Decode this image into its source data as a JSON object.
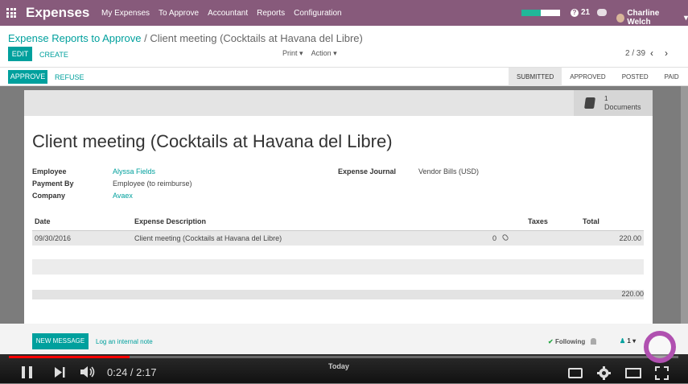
{
  "app": {
    "title": "Expenses"
  },
  "menu": [
    "My Expenses",
    "To Approve",
    "Accountant",
    "Reports",
    "Configuration"
  ],
  "systray": {
    "messages_count": "21",
    "user_name": "Charline Welch"
  },
  "breadcrumb": {
    "parent": "Expense Reports to Approve",
    "separator": "/",
    "current": "Client meeting (Cocktails at Havana del Libre)"
  },
  "control": {
    "edit_label": "EDIT",
    "create_label": "CREATE",
    "print_label": "Print",
    "action_label": "Action",
    "pager": "2 / 39"
  },
  "status": {
    "approve_label": "APPROVE",
    "refuse_label": "REFUSE",
    "stages": [
      "SUBMITTED",
      "APPROVED",
      "POSTED",
      "PAID"
    ],
    "active_stage": "SUBMITTED"
  },
  "documents": {
    "count": "1",
    "label": "Documents"
  },
  "record": {
    "title": "Client meeting (Cocktails at Havana del Libre)",
    "employee_label": "Employee",
    "employee": "Alyssa Fields",
    "payment_by_label": "Payment By",
    "payment_by": "Employee (to reimburse)",
    "company_label": "Company",
    "company": "Avaex",
    "journal_label": "Expense Journal",
    "journal": "Vendor Bills (USD)"
  },
  "table": {
    "headers": {
      "date": "Date",
      "description": "Expense Description",
      "taxes": "Taxes",
      "total": "Total"
    },
    "rows": [
      {
        "date": "09/30/2016",
        "description": "Client meeting (Cocktails at Havana del Libre)",
        "attachments": "0",
        "total": "220.00"
      }
    ],
    "grand_total": "220.00"
  },
  "chatter": {
    "new_message_label": "NEW MESSAGE",
    "log_note_label": "Log an internal note",
    "following_label": "Following",
    "followers_count": "1"
  },
  "video": {
    "time": "0:24 / 2:17",
    "progress": 0.18,
    "today_label": "Today"
  },
  "colors": {
    "brand": "#875a7b",
    "accent": "#00a09d",
    "scrub": "#ff0000"
  }
}
